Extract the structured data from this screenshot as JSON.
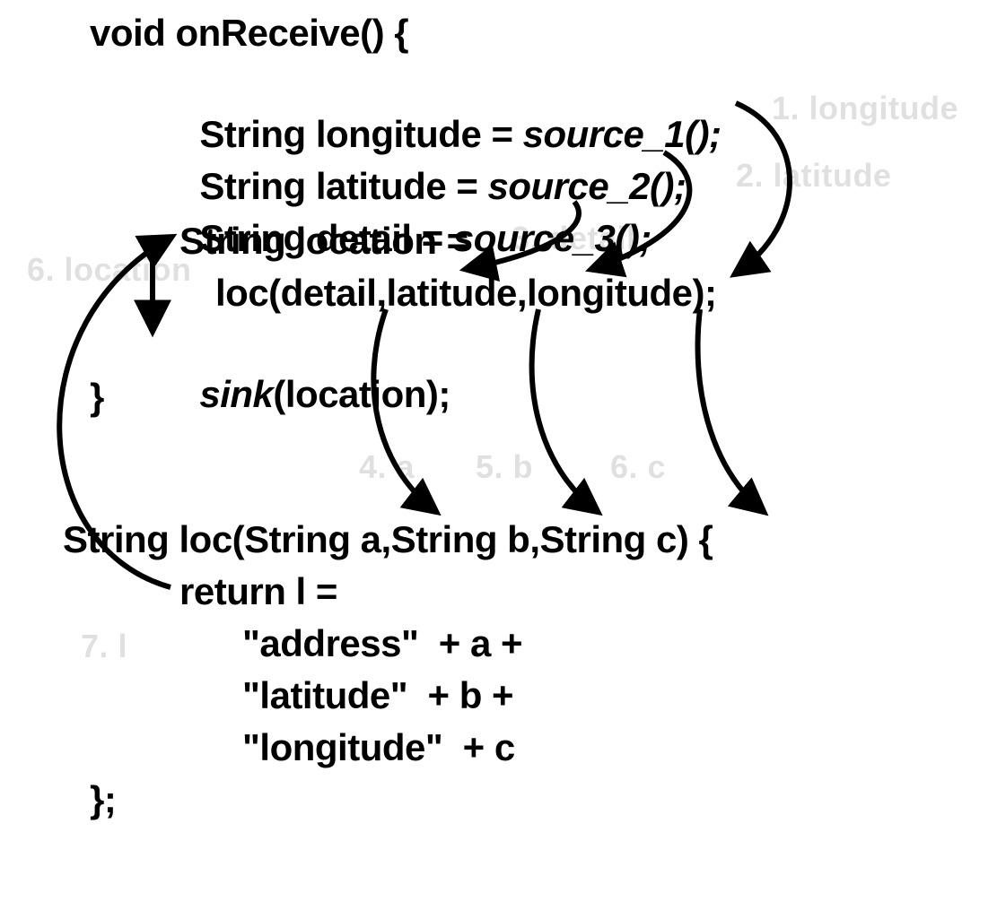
{
  "onReceive": {
    "signature": "void onReceive() {",
    "line1": "String longitude = ",
    "call1": "source_1();",
    "line2": "String latitude = ",
    "call2": "source_2();",
    "line3": "String detail = ",
    "call3": "source_3();",
    "line4": "String location =",
    "line5": "loc(detail,latitude,longitude);",
    "sinkCall": "sink",
    "sinkArg": "(location);",
    "close": "}"
  },
  "locFn": {
    "signature": "String loc(String a,String b,String c) {",
    "ret": "return l =",
    "l1": "\"address\"  + a +",
    "l2": "\"latitude\"  + b +",
    "l3": "\"longitude\"  + c",
    "close": "};"
  },
  "labels": {
    "longitude": "1. longitude",
    "latitude": "2. latitude",
    "detail": "3. detail",
    "location": "6. location",
    "a": "4. a",
    "b": "5. b",
    "c": "6. c",
    "l": "7. l"
  },
  "dataflow_edges": [
    {
      "from": "longitude (source_1)",
      "to": "loc param longitude",
      "id": 1
    },
    {
      "from": "latitude (source_2)",
      "to": "loc param latitude",
      "id": 2
    },
    {
      "from": "detail (source_3)",
      "to": "loc param detail",
      "id": 3
    },
    {
      "from": "loc param detail",
      "to": "formal a (loc)",
      "id": 4
    },
    {
      "from": "loc param latitude",
      "to": "formal b (loc)",
      "id": 5
    },
    {
      "from": "loc param longitude",
      "to": "formal c (loc)",
      "id": 6
    },
    {
      "from": "return l (loc)",
      "to": "location",
      "id": 7
    },
    {
      "from": "location",
      "to": "sink(location)",
      "id": 8
    }
  ]
}
